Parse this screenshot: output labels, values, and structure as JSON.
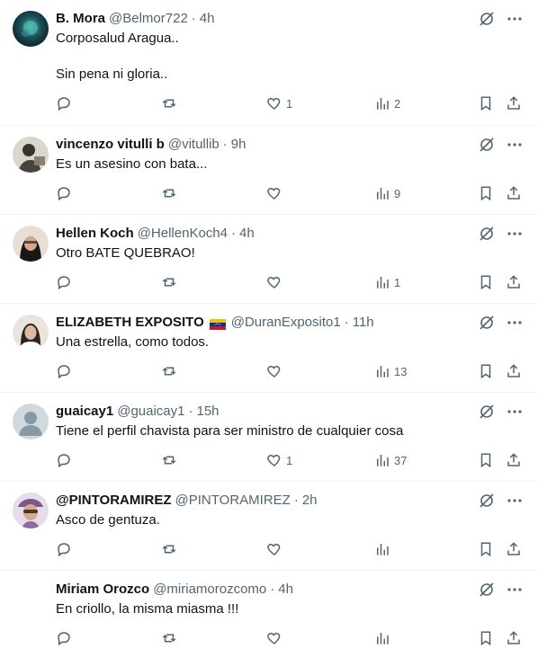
{
  "tweets": [
    {
      "name": "B. Mora",
      "handle": "@Belmor722",
      "time": "4h",
      "text": "Corposalud Aragua..\n\nSin pena ni gloria..",
      "likes": "1",
      "views": "2",
      "avatar": "photo-dark",
      "flag": ""
    },
    {
      "name": "vincenzo vitulli b",
      "handle": "@vitullib",
      "time": "9h",
      "text": "Es un asesino con bata...",
      "likes": "",
      "views": "9",
      "avatar": "photo-man",
      "flag": ""
    },
    {
      "name": "Hellen Koch",
      "handle": "@HellenKoch4",
      "time": "4h",
      "text": "Otro BATE QUEBRAO!",
      "likes": "",
      "views": "1",
      "avatar": "photo-woman",
      "flag": ""
    },
    {
      "name": "ELIZABETH EXPOSITO",
      "handle": "@DuranExposito1",
      "time": "11h",
      "text": "Una estrella, como todos.",
      "likes": "",
      "views": "13",
      "avatar": "photo-woman-light",
      "flag": "venezuela-flag"
    },
    {
      "name": "guaicay1",
      "handle": "@guaicay1",
      "time": "15h",
      "text": "Tiene el perfil chavista para ser ministro de cualquier cosa",
      "likes": "1",
      "views": "37",
      "avatar": "default",
      "flag": ""
    },
    {
      "name": "@PINTORAMIREZ",
      "handle": "@PINTORAMIREZ",
      "time": "2h",
      "text": "Asco de gentuza.",
      "likes": "",
      "views": "",
      "avatar": "photo-woman-hat",
      "flag": ""
    },
    {
      "name": "Miriam Orozco",
      "handle": "@miriamorozcomo",
      "time": "4h",
      "text": "En criollo, la misma miasma !!!",
      "likes": "",
      "views": "",
      "avatar": "none",
      "flag": ""
    }
  ],
  "separator": "·",
  "colors": {
    "text": "#0f1419",
    "secondary": "#536471",
    "border": "#eff3f4"
  },
  "icons": [
    "grok-icon",
    "more-icon",
    "reply-icon",
    "retweet-icon",
    "like-icon",
    "views-icon",
    "bookmark-icon",
    "share-icon"
  ]
}
